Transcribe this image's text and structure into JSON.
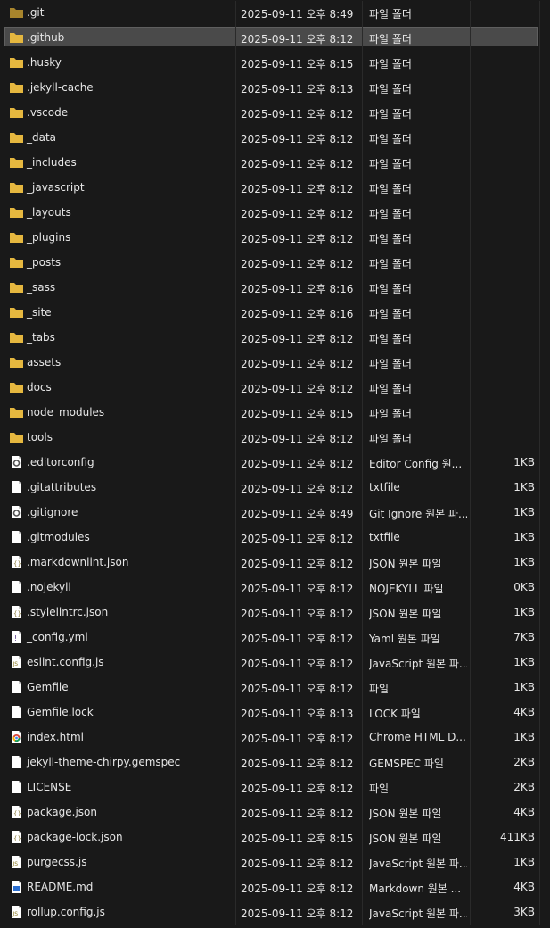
{
  "colors": {
    "background": "#191919",
    "folder": "#e5b73f",
    "folder_dim": "#a8852d",
    "selection": "#4a4a4a",
    "text": "#e6e6e6"
  },
  "rows": [
    {
      "name": ".git",
      "date": "2025-09-11 오후 8:49",
      "type": "파일 폴더",
      "size": "",
      "kind": "folder-dim"
    },
    {
      "name": ".github",
      "date": "2025-09-11 오후 8:12",
      "type": "파일 폴더",
      "size": "",
      "kind": "folder",
      "selected": true
    },
    {
      "name": ".husky",
      "date": "2025-09-11 오후 8:15",
      "type": "파일 폴더",
      "size": "",
      "kind": "folder"
    },
    {
      "name": ".jekyll-cache",
      "date": "2025-09-11 오후 8:13",
      "type": "파일 폴더",
      "size": "",
      "kind": "folder"
    },
    {
      "name": ".vscode",
      "date": "2025-09-11 오후 8:12",
      "type": "파일 폴더",
      "size": "",
      "kind": "folder"
    },
    {
      "name": "_data",
      "date": "2025-09-11 오후 8:12",
      "type": "파일 폴더",
      "size": "",
      "kind": "folder"
    },
    {
      "name": "_includes",
      "date": "2025-09-11 오후 8:12",
      "type": "파일 폴더",
      "size": "",
      "kind": "folder"
    },
    {
      "name": "_javascript",
      "date": "2025-09-11 오후 8:12",
      "type": "파일 폴더",
      "size": "",
      "kind": "folder"
    },
    {
      "name": "_layouts",
      "date": "2025-09-11 오후 8:12",
      "type": "파일 폴더",
      "size": "",
      "kind": "folder"
    },
    {
      "name": "_plugins",
      "date": "2025-09-11 오후 8:12",
      "type": "파일 폴더",
      "size": "",
      "kind": "folder"
    },
    {
      "name": "_posts",
      "date": "2025-09-11 오후 8:12",
      "type": "파일 폴더",
      "size": "",
      "kind": "folder"
    },
    {
      "name": "_sass",
      "date": "2025-09-11 오후 8:16",
      "type": "파일 폴더",
      "size": "",
      "kind": "folder"
    },
    {
      "name": "_site",
      "date": "2025-09-11 오후 8:16",
      "type": "파일 폴더",
      "size": "",
      "kind": "folder"
    },
    {
      "name": "_tabs",
      "date": "2025-09-11 오후 8:12",
      "type": "파일 폴더",
      "size": "",
      "kind": "folder"
    },
    {
      "name": "assets",
      "date": "2025-09-11 오후 8:12",
      "type": "파일 폴더",
      "size": "",
      "kind": "folder"
    },
    {
      "name": "docs",
      "date": "2025-09-11 오후 8:12",
      "type": "파일 폴더",
      "size": "",
      "kind": "folder"
    },
    {
      "name": "node_modules",
      "date": "2025-09-11 오후 8:15",
      "type": "파일 폴더",
      "size": "",
      "kind": "folder"
    },
    {
      "name": "tools",
      "date": "2025-09-11 오후 8:12",
      "type": "파일 폴더",
      "size": "",
      "kind": "folder"
    },
    {
      "name": ".editorconfig",
      "date": "2025-09-11 오후 8:12",
      "type": "Editor Config 원...",
      "size": "1KB",
      "kind": "gear"
    },
    {
      "name": ".gitattributes",
      "date": "2025-09-11 오후 8:12",
      "type": "txtfile",
      "size": "1KB",
      "kind": "file"
    },
    {
      "name": ".gitignore",
      "date": "2025-09-11 오후 8:49",
      "type": "Git Ignore 원본 파...",
      "size": "1KB",
      "kind": "gear"
    },
    {
      "name": ".gitmodules",
      "date": "2025-09-11 오후 8:12",
      "type": "txtfile",
      "size": "1KB",
      "kind": "file"
    },
    {
      "name": ".markdownlint.json",
      "date": "2025-09-11 오후 8:12",
      "type": "JSON 원본 파일",
      "size": "1KB",
      "kind": "json"
    },
    {
      "name": ".nojekyll",
      "date": "2025-09-11 오후 8:12",
      "type": "NOJEKYLL 파일",
      "size": "0KB",
      "kind": "file"
    },
    {
      "name": ".stylelintrc.json",
      "date": "2025-09-11 오후 8:12",
      "type": "JSON 원본 파일",
      "size": "1KB",
      "kind": "json"
    },
    {
      "name": "_config.yml",
      "date": "2025-09-11 오후 8:12",
      "type": "Yaml 원본 파일",
      "size": "7KB",
      "kind": "yaml"
    },
    {
      "name": "eslint.config.js",
      "date": "2025-09-11 오후 8:12",
      "type": "JavaScript 원본 파...",
      "size": "1KB",
      "kind": "js"
    },
    {
      "name": "Gemfile",
      "date": "2025-09-11 오후 8:12",
      "type": "파일",
      "size": "1KB",
      "kind": "file"
    },
    {
      "name": "Gemfile.lock",
      "date": "2025-09-11 오후 8:13",
      "type": "LOCK 파일",
      "size": "4KB",
      "kind": "file"
    },
    {
      "name": "index.html",
      "date": "2025-09-11 오후 8:12",
      "type": "Chrome HTML D...",
      "size": "1KB",
      "kind": "chrome"
    },
    {
      "name": "jekyll-theme-chirpy.gemspec",
      "date": "2025-09-11 오후 8:12",
      "type": "GEMSPEC 파일",
      "size": "2KB",
      "kind": "file"
    },
    {
      "name": "LICENSE",
      "date": "2025-09-11 오후 8:12",
      "type": "파일",
      "size": "2KB",
      "kind": "file"
    },
    {
      "name": "package.json",
      "date": "2025-09-11 오후 8:12",
      "type": "JSON 원본 파일",
      "size": "4KB",
      "kind": "json"
    },
    {
      "name": "package-lock.json",
      "date": "2025-09-11 오후 8:15",
      "type": "JSON 원본 파일",
      "size": "411KB",
      "kind": "json"
    },
    {
      "name": "purgecss.js",
      "date": "2025-09-11 오후 8:12",
      "type": "JavaScript 원본 파...",
      "size": "1KB",
      "kind": "js"
    },
    {
      "name": "README.md",
      "date": "2025-09-11 오후 8:12",
      "type": "Markdown 원본 ...",
      "size": "4KB",
      "kind": "md"
    },
    {
      "name": "rollup.config.js",
      "date": "2025-09-11 오후 8:12",
      "type": "JavaScript 원본 파...",
      "size": "3KB",
      "kind": "js"
    }
  ]
}
